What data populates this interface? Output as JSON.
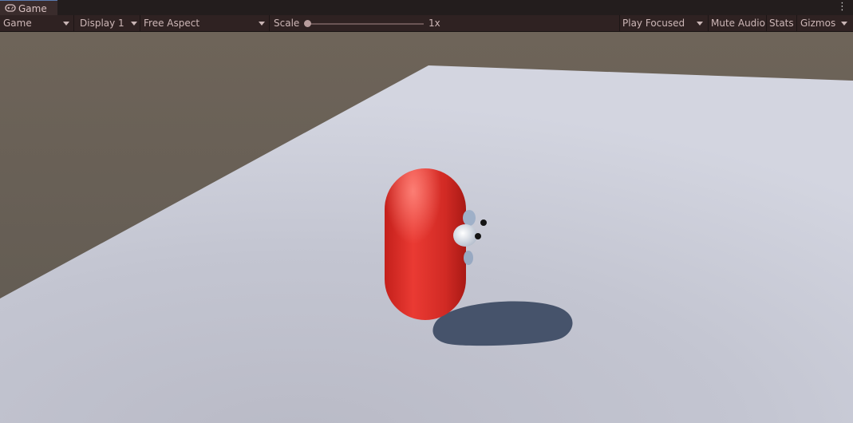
{
  "tab": {
    "label": "Game",
    "icon": "gamepad-icon"
  },
  "toolbar": {
    "mode": "Game",
    "display": "Display 1",
    "aspect": "Free Aspect",
    "scale_label": "Scale",
    "scale_value_label": "1x",
    "scale_fraction": 0.0,
    "play_focused": "Play Focused",
    "mute_audio": "Mute Audio",
    "stats": "Stats",
    "gizmos": "Gizmos"
  },
  "colors": {
    "floor": "#c9cbd6",
    "sky": "#6c6257",
    "capsule": "#e5342d",
    "shadow": "#46536b",
    "accent": "#5a7bb0"
  }
}
